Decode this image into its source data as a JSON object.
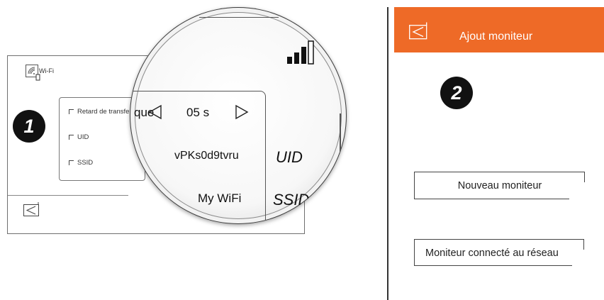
{
  "left_screen": {
    "header": {
      "title": "Wi-Fi",
      "icon": "wifi-device-icon"
    },
    "options": [
      {
        "label": "Retard de transfert"
      },
      {
        "label": "UID"
      },
      {
        "label": "SSID"
      }
    ],
    "back_icon": "back-icon",
    "step": "1"
  },
  "magnifier": {
    "trail_text": "que",
    "delay_value": "05 s",
    "uid_value": "vPKs0d9tvru",
    "uid_label": "UID",
    "ssid_value": "My WiFi",
    "ssid_label": "SSID",
    "signal_icon": "signal-strength-icon"
  },
  "right_screen": {
    "header": {
      "title": "Ajout moniteur",
      "color": "#ee6a27",
      "back_icon": "back-icon"
    },
    "step": "2",
    "buttons": [
      {
        "label": "Nouveau moniteur"
      },
      {
        "label": "Moniteur connecté au réseau"
      }
    ]
  }
}
